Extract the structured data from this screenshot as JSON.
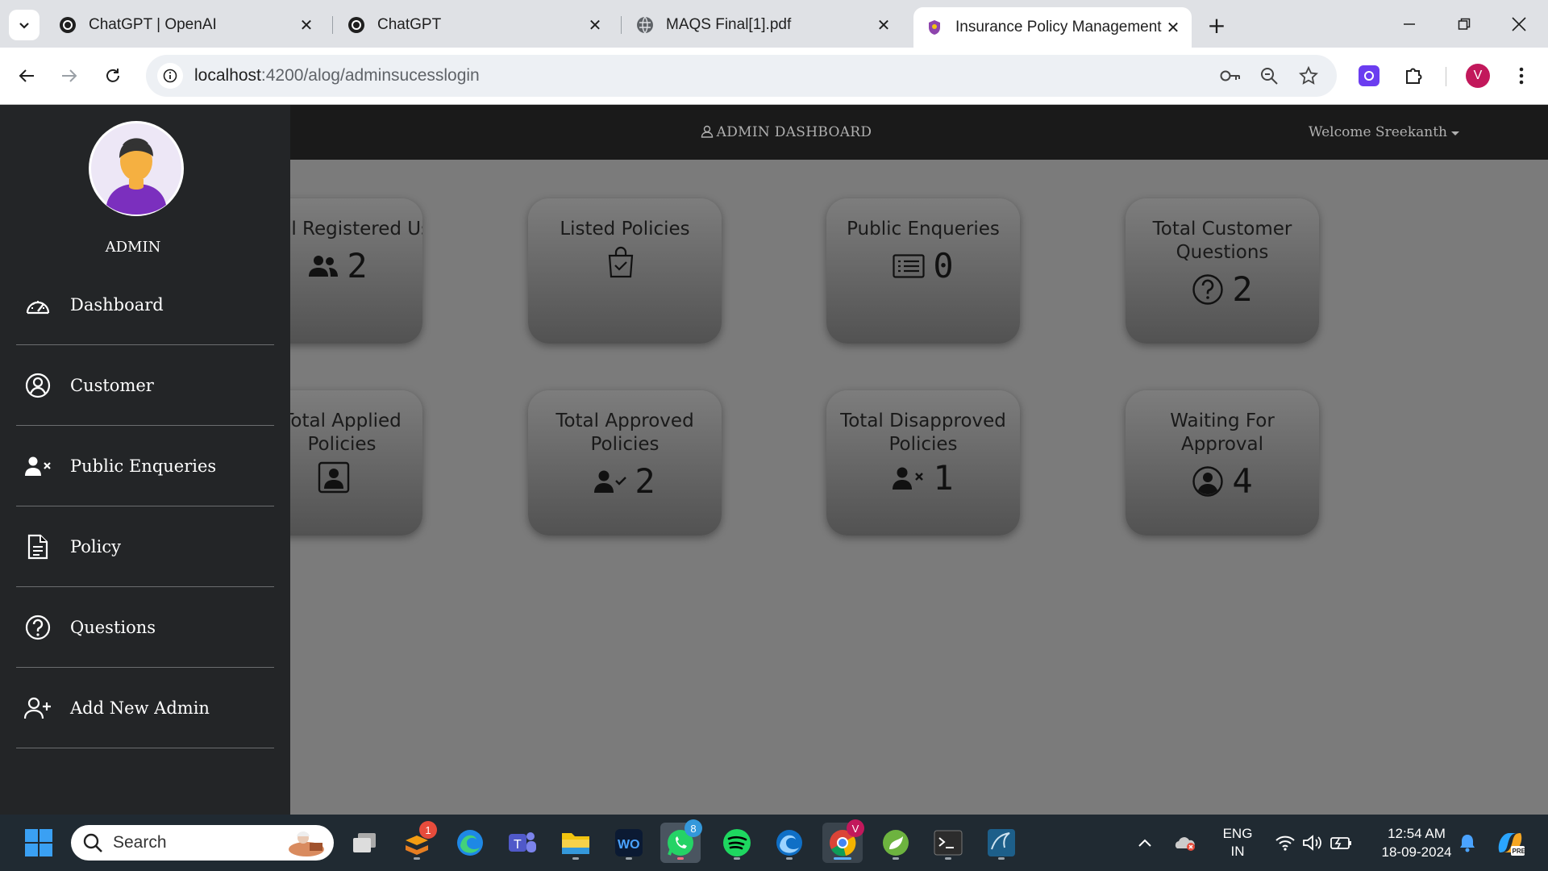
{
  "browser": {
    "tabs": [
      {
        "title": "ChatGPT | OpenAI",
        "icon": "openai-icon"
      },
      {
        "title": "ChatGPT",
        "icon": "openai-icon"
      },
      {
        "title": "MAQS Final[1].pdf",
        "icon": "globe-icon"
      },
      {
        "title": "Insurance Policy Management",
        "icon": "app-favicon",
        "active": true
      }
    ],
    "url_host": "localhost",
    "url_path": ":4200/alog/adminsucesslogin",
    "profile_initial": "V"
  },
  "app": {
    "header_title": "ADMIN DASHBOARD",
    "welcome": "Welcome Sreekanth",
    "admin_label": "ADMIN",
    "sidebar": [
      {
        "label": "Dashboard",
        "icon": "dashboard-gauge-icon"
      },
      {
        "label": "Customer",
        "icon": "user-circle-icon"
      },
      {
        "label": "Public Enqueries",
        "icon": "user-x-icon"
      },
      {
        "label": "Policy",
        "icon": "document-icon"
      },
      {
        "label": "Questions",
        "icon": "question-circle-icon"
      },
      {
        "label": "Add New Admin",
        "icon": "user-plus-icon"
      }
    ],
    "cards": [
      {
        "title": "Total Registered Users",
        "value": "2",
        "icon": "users-icon"
      },
      {
        "title": "Listed Policies",
        "value": "",
        "icon": "bag-check-icon"
      },
      {
        "title": "Public Enqueries",
        "value": "0",
        "icon": "list-icon"
      },
      {
        "title": "Total Customer Questions",
        "value": "2",
        "icon": "question-circle-icon"
      },
      {
        "title": "Total Applied Policies",
        "value": "",
        "icon": "portrait-icon"
      },
      {
        "title": "Total Approved Policies",
        "value": "2",
        "icon": "user-check-icon"
      },
      {
        "title": "Total Disapproved Policies",
        "value": "1",
        "icon": "user-x-icon"
      },
      {
        "title": "Waiting For Approval",
        "value": "4",
        "icon": "user-circle-icon"
      }
    ]
  },
  "taskbar": {
    "search_placeholder": "Search",
    "badges": {
      "app1": "1",
      "whatsapp": "8",
      "chrome_profile": "V"
    },
    "lang_line1": "ENG",
    "lang_line2": "IN",
    "time": "12:54 AM",
    "date": "18-09-2024"
  }
}
